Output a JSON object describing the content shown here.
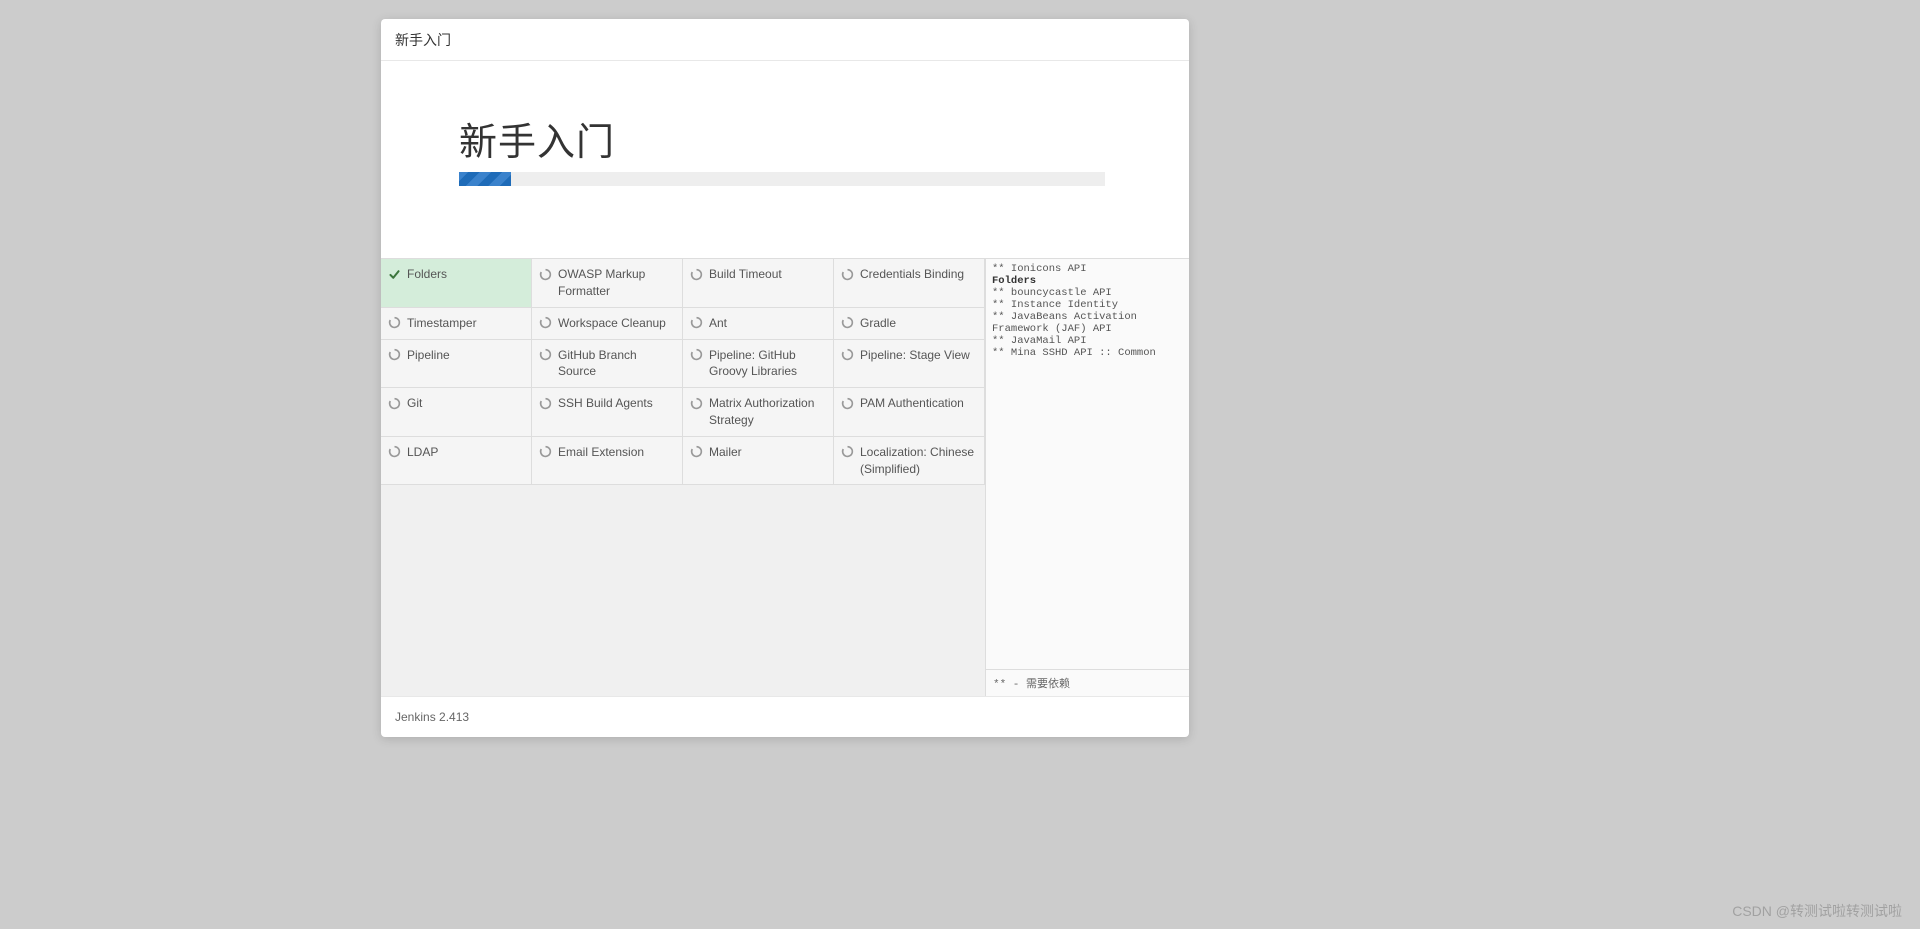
{
  "header": {
    "title": "新手入门"
  },
  "hero": {
    "title": "新手入门"
  },
  "progress": {
    "percent": 8
  },
  "plugins": [
    {
      "label": "Folders",
      "status": "success"
    },
    {
      "label": "OWASP Markup Formatter",
      "status": "pending"
    },
    {
      "label": "Build Timeout",
      "status": "pending"
    },
    {
      "label": "Credentials Binding",
      "status": "pending"
    },
    {
      "label": "Timestamper",
      "status": "pending"
    },
    {
      "label": "Workspace Cleanup",
      "status": "pending"
    },
    {
      "label": "Ant",
      "status": "pending"
    },
    {
      "label": "Gradle",
      "status": "pending"
    },
    {
      "label": "Pipeline",
      "status": "pending"
    },
    {
      "label": "GitHub Branch Source",
      "status": "pending"
    },
    {
      "label": "Pipeline: GitHub Groovy Libraries",
      "status": "pending"
    },
    {
      "label": "Pipeline: Stage View",
      "status": "pending"
    },
    {
      "label": "Git",
      "status": "pending"
    },
    {
      "label": "SSH Build Agents",
      "status": "pending"
    },
    {
      "label": "Matrix Authorization Strategy",
      "status": "pending"
    },
    {
      "label": "PAM Authentication",
      "status": "pending"
    },
    {
      "label": "LDAP",
      "status": "pending"
    },
    {
      "label": "Email Extension",
      "status": "pending"
    },
    {
      "label": "Mailer",
      "status": "pending"
    },
    {
      "label": "Localization: Chinese (Simplified)",
      "status": "pending"
    }
  ],
  "log": {
    "lines": [
      {
        "text": "** Ionicons API",
        "strong": false
      },
      {
        "text": "Folders",
        "strong": true
      },
      {
        "text": "** bouncycastle API",
        "strong": false
      },
      {
        "text": "** Instance Identity",
        "strong": false
      },
      {
        "text": "** JavaBeans Activation Framework (JAF) API",
        "strong": false
      },
      {
        "text": "** JavaMail API",
        "strong": false
      },
      {
        "text": "** Mina SSHD API :: Common",
        "strong": false
      }
    ],
    "footer": "** - 需要依赖"
  },
  "footer": {
    "version": "Jenkins 2.413"
  },
  "watermark": "CSDN @转测试啦转测试啦"
}
